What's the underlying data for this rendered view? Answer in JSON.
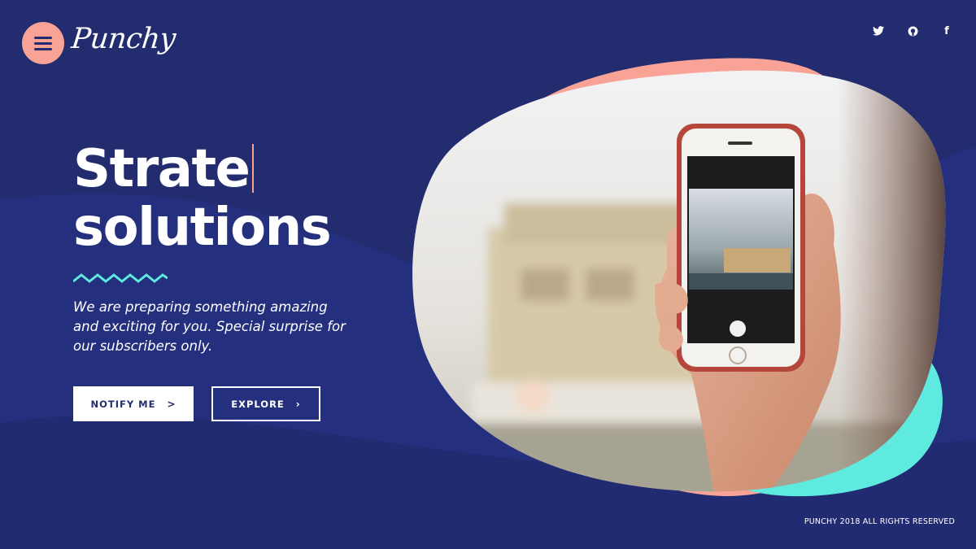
{
  "brand": {
    "logo_text": "Punchy",
    "accent_color": "#f8a396",
    "teal_color": "#5eeadf",
    "background_color": "#232c6e"
  },
  "header": {
    "menu_icon": "hamburger-menu-icon",
    "socials": [
      {
        "name": "twitter",
        "icon": "twitter-icon"
      },
      {
        "name": "github",
        "icon": "github-icon"
      },
      {
        "name": "facebook",
        "icon": "facebook-icon",
        "glyph": "f"
      }
    ]
  },
  "hero": {
    "headline_line1": "Strate",
    "headline_line2": "solutions",
    "tagline": "We are preparing something amazing and exciting for you. Special surprise for our subscribers only.",
    "buttons": {
      "notify_label": "NOTIFY ME",
      "notify_arrow": ">",
      "explore_label": "EXPLORE",
      "explore_arrow": "›"
    }
  },
  "image": {
    "subject": "hand holding a smartphone photographing a waterfront building"
  },
  "footer": {
    "copyright": "PUNCHY 2018 ALL RIGHTS RESERVED"
  }
}
